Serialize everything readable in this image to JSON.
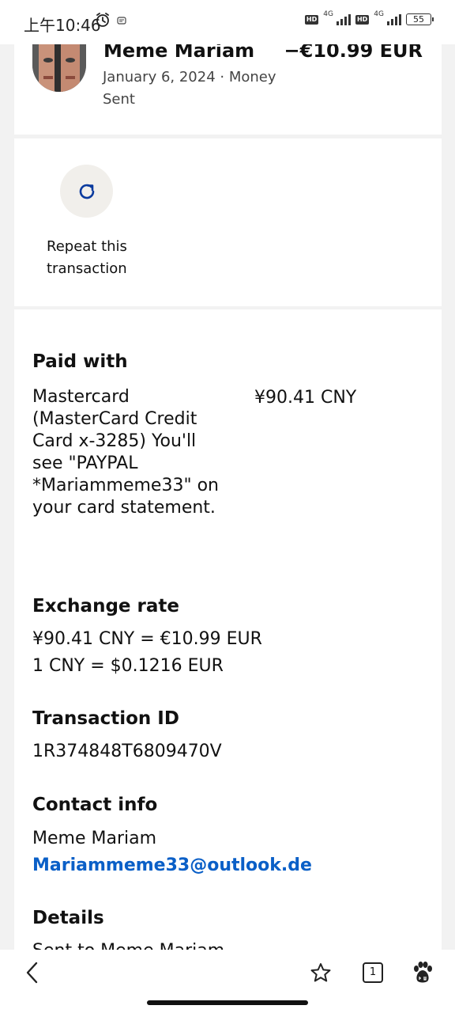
{
  "status": {
    "time": "上午10:46",
    "net1": "4G",
    "net2": "4G",
    "hd": "HD",
    "battery": "55"
  },
  "transaction": {
    "name": "Meme Mariam",
    "date_type": "January 6, 2024 · Money Sent",
    "amount": "−€10.99 EUR"
  },
  "repeat": {
    "label": "Repeat this transaction"
  },
  "paid_with": {
    "title": "Paid with",
    "description": "Mastercard (MasterCard Credit Card x-3285) You'll see \"PAYPAL *Mariammeme33\" on your card statement.",
    "amount": "¥90.41 CNY"
  },
  "exchange": {
    "title": "Exchange rate",
    "line1": "¥90.41 CNY = €10.99 EUR",
    "line2": "1 CNY = $0.1216 EUR"
  },
  "transaction_id": {
    "title": "Transaction ID",
    "value": "1R374848T6809470V"
  },
  "contact": {
    "title": "Contact info",
    "name": "Meme Mariam",
    "email": "Mariammeme33@outlook.de"
  },
  "details": {
    "title": "Details",
    "partial_line": "Sent to Meme Mariam"
  },
  "browser_nav": {
    "tab_count": "1"
  },
  "icons": {
    "alarm": "alarm-icon",
    "notification": "notification-icon",
    "repeat": "refresh-icon",
    "back": "back-arrow-icon",
    "bookmark": "star-icon",
    "tabs": "tabs-icon",
    "baidu": "baidu-paw-icon"
  },
  "colors": {
    "link": "#0a5fc7",
    "repeat_icon": "#0a3a9e"
  }
}
